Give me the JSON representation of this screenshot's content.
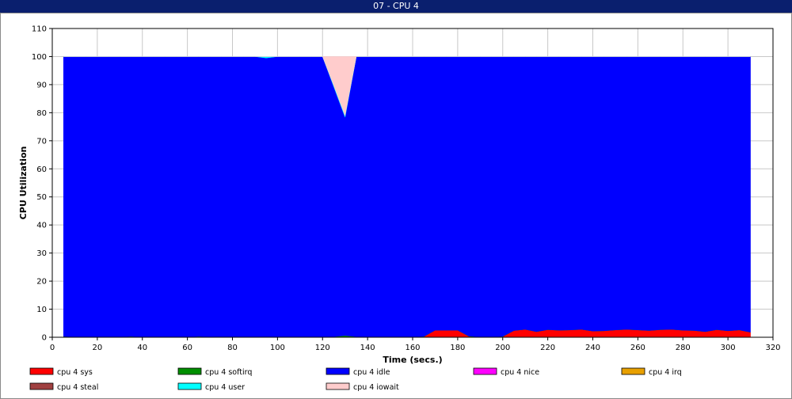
{
  "window": {
    "title": "07 - CPU 4"
  },
  "chart_data": {
    "type": "area",
    "stacked": true,
    "title": "",
    "xlabel": "Time (secs.)",
    "ylabel": "CPU Utilization",
    "xlim": [
      0,
      320
    ],
    "ylim": [
      0,
      110
    ],
    "xticks": [
      0,
      20,
      40,
      60,
      80,
      100,
      120,
      140,
      160,
      180,
      200,
      220,
      240,
      260,
      280,
      300,
      320
    ],
    "yticks": [
      0,
      10,
      20,
      30,
      40,
      50,
      60,
      70,
      80,
      90,
      100,
      110
    ],
    "grid": true,
    "legend_position": "bottom",
    "x": [
      5,
      10,
      15,
      20,
      25,
      30,
      35,
      40,
      45,
      50,
      55,
      60,
      65,
      70,
      75,
      80,
      85,
      90,
      95,
      100,
      105,
      110,
      115,
      120,
      125,
      130,
      135,
      140,
      145,
      150,
      155,
      160,
      165,
      170,
      175,
      180,
      185,
      190,
      195,
      200,
      205,
      210,
      215,
      220,
      225,
      230,
      235,
      240,
      245,
      250,
      255,
      260,
      265,
      270,
      275,
      280,
      285,
      290,
      295,
      300,
      305,
      310
    ],
    "series": [
      {
        "name": "cpu 4 sys",
        "color": "#ff0000",
        "values": [
          0,
          0,
          0,
          0,
          0,
          0,
          0,
          0,
          0,
          0,
          0,
          0,
          0,
          0,
          0,
          0,
          0,
          0,
          0,
          0,
          0,
          0,
          0,
          0,
          0,
          0,
          0,
          0,
          0,
          0,
          0,
          0,
          0.2,
          2.5,
          2.5,
          2.5,
          0.3,
          0,
          0,
          0.2,
          2.4,
          2.8,
          2.0,
          2.7,
          2.5,
          2.6,
          2.8,
          2.2,
          2.3,
          2.6,
          2.8,
          2.6,
          2.4,
          2.7,
          2.8,
          2.5,
          2.4,
          2.0,
          2.7,
          2.3,
          2.6,
          1.8
        ]
      },
      {
        "name": "cpu 4 softirq",
        "color": "#008f00",
        "values": [
          0.3,
          0.1,
          0.1,
          0.1,
          0.1,
          0.1,
          0.3,
          0.1,
          0.1,
          0.1,
          0.1,
          0.1,
          0.3,
          0.1,
          0.2,
          0.2,
          0.1,
          0.1,
          0.2,
          0.1,
          0.1,
          0.1,
          0.1,
          0.1,
          0.2,
          0.6,
          0.2,
          0.1,
          0.1,
          0.1,
          0.1,
          0.1,
          0.1,
          0,
          0,
          0,
          0.1,
          0.1,
          0.1,
          0.1,
          0,
          0,
          0,
          0,
          0,
          0,
          0,
          0,
          0,
          0,
          0,
          0,
          0,
          0,
          0,
          0,
          0,
          0,
          0,
          0,
          0,
          0
        ]
      },
      {
        "name": "cpu 4 idle",
        "color": "#0000ff",
        "values": [
          99.7,
          99.9,
          99.9,
          99.9,
          99.9,
          99.9,
          99.7,
          99.9,
          99.9,
          99.9,
          99.9,
          99.9,
          99.7,
          99.9,
          99.8,
          99.8,
          99.9,
          99.9,
          99.3,
          99.9,
          99.9,
          99.9,
          99.9,
          99.9,
          89.0,
          77.8,
          99.8,
          99.9,
          99.9,
          99.9,
          99.9,
          99.9,
          99.7,
          97.5,
          97.5,
          97.5,
          99.6,
          99.9,
          99.9,
          99.7,
          97.6,
          97.2,
          98.0,
          97.3,
          97.5,
          97.4,
          97.2,
          97.8,
          97.7,
          97.4,
          97.2,
          97.4,
          97.6,
          97.3,
          97.2,
          97.5,
          97.6,
          98.0,
          97.3,
          97.7,
          97.4,
          98.2
        ]
      },
      {
        "name": "cpu 4 nice",
        "color": "#ff00ff",
        "values": [
          0,
          0,
          0,
          0,
          0,
          0,
          0,
          0,
          0,
          0,
          0,
          0,
          0,
          0,
          0,
          0,
          0,
          0,
          0,
          0,
          0,
          0,
          0,
          0,
          0,
          0,
          0,
          0,
          0,
          0,
          0,
          0,
          0,
          0,
          0,
          0,
          0,
          0,
          0,
          0,
          0,
          0,
          0,
          0,
          0,
          0,
          0,
          0,
          0,
          0,
          0,
          0,
          0,
          0,
          0,
          0,
          0,
          0,
          0,
          0,
          0,
          0
        ]
      },
      {
        "name": "cpu 4 irq",
        "color": "#e8a000",
        "values": [
          0,
          0,
          0,
          0,
          0,
          0,
          0,
          0,
          0,
          0,
          0,
          0,
          0,
          0,
          0,
          0,
          0,
          0,
          0,
          0,
          0,
          0,
          0,
          0,
          0,
          0,
          0,
          0,
          0,
          0,
          0,
          0,
          0,
          0,
          0,
          0,
          0,
          0,
          0,
          0,
          0,
          0,
          0,
          0,
          0,
          0,
          0,
          0,
          0,
          0,
          0,
          0,
          0,
          0,
          0,
          0,
          0,
          0,
          0,
          0,
          0,
          0
        ]
      },
      {
        "name": "cpu 4 steal",
        "color": "#a04040",
        "values": [
          0,
          0,
          0,
          0,
          0,
          0,
          0,
          0,
          0,
          0,
          0,
          0,
          0,
          0,
          0,
          0,
          0,
          0,
          0,
          0,
          0,
          0,
          0,
          0,
          0,
          0,
          0,
          0,
          0,
          0,
          0,
          0,
          0,
          0,
          0,
          0,
          0,
          0,
          0,
          0,
          0,
          0,
          0,
          0,
          0,
          0,
          0,
          0,
          0,
          0,
          0,
          0,
          0,
          0,
          0,
          0,
          0,
          0,
          0,
          0,
          0,
          0
        ]
      },
      {
        "name": "cpu 4 user",
        "color": "#00ffff",
        "values": [
          0,
          0,
          0,
          0,
          0,
          0,
          0,
          0,
          0,
          0,
          0,
          0,
          0,
          0,
          0,
          0,
          0,
          0,
          0.5,
          0,
          0,
          0,
          0,
          0,
          0.4,
          0.5,
          0,
          0,
          0,
          0,
          0,
          0,
          0,
          0,
          0,
          0,
          0,
          0,
          0,
          0,
          0,
          0,
          0,
          0,
          0,
          0,
          0,
          0,
          0,
          0,
          0,
          0,
          0,
          0,
          0,
          0,
          0,
          0,
          0,
          0,
          0,
          0
        ]
      },
      {
        "name": "cpu 4 iowait",
        "color": "#ffcccc",
        "values": [
          0,
          0,
          0,
          0,
          0,
          0,
          0,
          0,
          0,
          0,
          0,
          0,
          0,
          0,
          0,
          0,
          0,
          0,
          0,
          0,
          0,
          0,
          0,
          0,
          10.4,
          21.1,
          0,
          0,
          0,
          0,
          0,
          0,
          0,
          0,
          0,
          0,
          0,
          0,
          0,
          0,
          0,
          0,
          0,
          0,
          0,
          0,
          0,
          0,
          0,
          0,
          0,
          0,
          0,
          0,
          0,
          0,
          0,
          0,
          0,
          0,
          0,
          0
        ]
      }
    ],
    "legend_order": [
      "cpu 4 sys",
      "cpu 4 softirq",
      "cpu 4 idle",
      "cpu 4 nice",
      "cpu 4 irq",
      "cpu 4 steal",
      "cpu 4 user",
      "cpu 4 iowait"
    ]
  }
}
